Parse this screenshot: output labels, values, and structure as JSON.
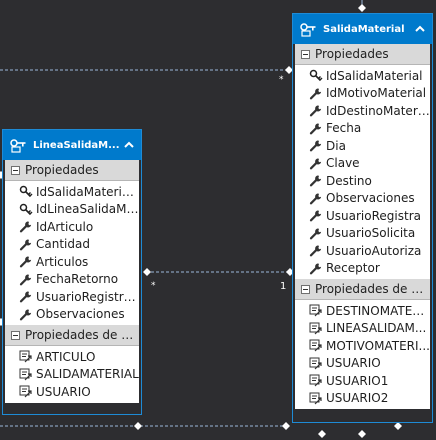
{
  "entities": [
    {
      "name": "LineaSalidaMaterial",
      "title": "LineaSalidaM...",
      "properties_header": "Propiedades",
      "properties": [
        {
          "label": "IdSalidaMaterialF",
          "icon": "key-icon"
        },
        {
          "label": "IdLineaSalidaMa...",
          "icon": "key-icon"
        },
        {
          "label": "IdArticulo",
          "icon": "wrench-icon"
        },
        {
          "label": "Cantidad",
          "icon": "wrench-icon"
        },
        {
          "label": "Articulos",
          "icon": "wrench-icon"
        },
        {
          "label": "FechaRetorno",
          "icon": "wrench-icon"
        },
        {
          "label": "UsuarioRegistra...",
          "icon": "wrench-icon"
        },
        {
          "label": "Observaciones",
          "icon": "wrench-icon"
        }
      ],
      "nav_header": "Propiedades de nav...",
      "nav_properties": [
        {
          "label": "ARTICULO",
          "icon": "navigation-property-icon"
        },
        {
          "label": "SALIDAMATERIAL",
          "icon": "navigation-property-icon"
        },
        {
          "label": "USUARIO",
          "icon": "navigation-property-icon"
        }
      ]
    },
    {
      "name": "SalidaMaterial",
      "title": "SalidaMaterial",
      "properties_header": "Propiedades",
      "properties": [
        {
          "label": "IdSalidaMaterial",
          "icon": "key-icon"
        },
        {
          "label": "IdMotivoMaterial",
          "icon": "wrench-icon"
        },
        {
          "label": "IdDestinoMaterial",
          "icon": "wrench-icon"
        },
        {
          "label": "Fecha",
          "icon": "wrench-icon"
        },
        {
          "label": "Dia",
          "icon": "wrench-icon"
        },
        {
          "label": "Clave",
          "icon": "wrench-icon"
        },
        {
          "label": "Destino",
          "icon": "wrench-icon"
        },
        {
          "label": "Observaciones",
          "icon": "wrench-icon"
        },
        {
          "label": "UsuarioRegistra",
          "icon": "wrench-icon"
        },
        {
          "label": "UsuarioSolicita",
          "icon": "wrench-icon"
        },
        {
          "label": "UsuarioAutoriza",
          "icon": "wrench-icon"
        },
        {
          "label": "Receptor",
          "icon": "wrench-icon"
        }
      ],
      "nav_header": "Propiedades de nav...",
      "nav_properties": [
        {
          "label": "DESTINOMATER...",
          "icon": "navigation-property-icon"
        },
        {
          "label": "LINEASALIDAM...",
          "icon": "navigation-property-icon"
        },
        {
          "label": "MOTIVOMATERI...",
          "icon": "navigation-property-icon"
        },
        {
          "label": "USUARIO",
          "icon": "navigation-property-icon"
        },
        {
          "label": "USUARIO1",
          "icon": "navigation-property-icon"
        },
        {
          "label": "USUARIO2",
          "icon": "navigation-property-icon"
        }
      ]
    }
  ],
  "multiplicities": {
    "top_left_star": "*",
    "link_left_star": "*",
    "link_right_one": "1"
  },
  "colors": {
    "canvas": "#2d2d30",
    "header": "#007acc",
    "section": "#d9d9d9",
    "connector": "#6a9fd4"
  }
}
